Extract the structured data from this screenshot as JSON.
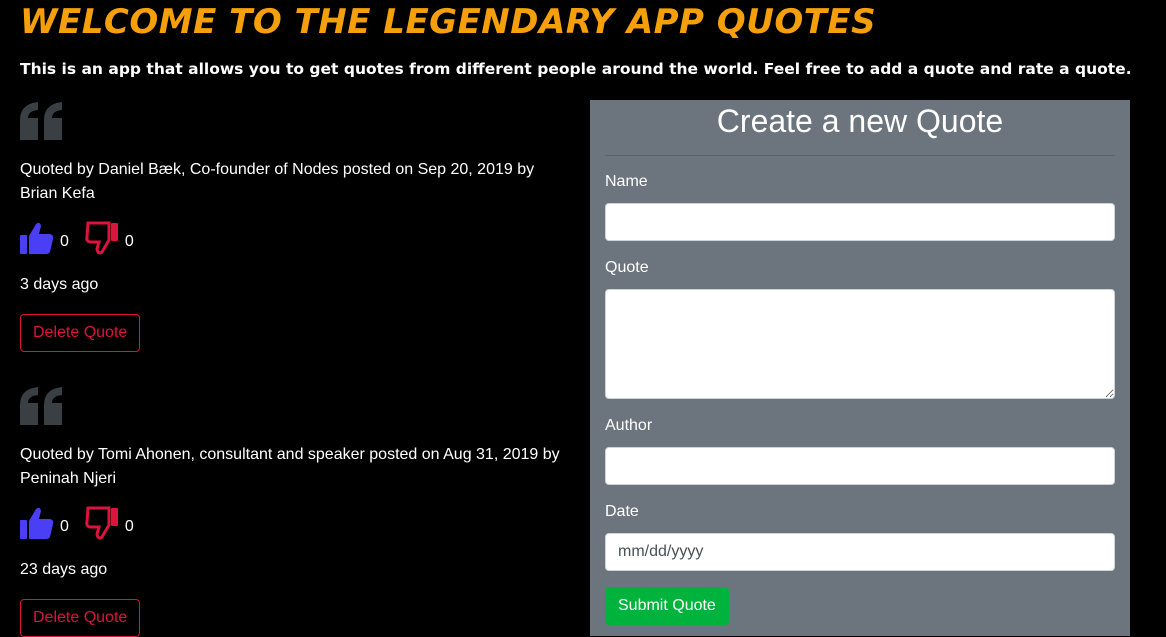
{
  "header": {
    "title": "WELCOME TO THE LEGENDARY APP QUOTES",
    "subtitle": "This is an app that allows you to get quotes from different people around the world. Feel free to add a quote and rate a quote."
  },
  "quotes": [
    {
      "meta": "Quoted by  Daniel Bæk, Co-founder of Nodes posted on Sep 20, 2019 by Brian Kefa",
      "upvotes": "0",
      "downvotes": "0",
      "time_ago": "3 days ago",
      "delete_label": "Delete Quote"
    },
    {
      "meta": "Quoted by Tomi Ahonen, consultant and speaker posted on Aug 31, 2019 by Peninah Njeri",
      "upvotes": "0",
      "downvotes": "0",
      "time_ago": "23 days ago",
      "delete_label": "Delete Quote"
    }
  ],
  "form": {
    "title": "Create a new Quote",
    "name_label": "Name",
    "name_value": "",
    "quote_label": "Quote",
    "quote_value": "",
    "author_label": "Author",
    "author_value": "",
    "date_label": "Date",
    "date_placeholder": "mm/dd/yyyy",
    "submit_label": "Submit Quote"
  },
  "colors": {
    "title": "#f5a00a",
    "panel": "#6c757d",
    "upvote": "#4a3ff5",
    "downvote": "#dc143c",
    "submit": "#00b33c",
    "quote_mark": "#3a3f44"
  },
  "icons": {
    "quote": "quote-left-icon",
    "upvote": "thumbs-up-icon",
    "downvote": "thumbs-down-icon"
  }
}
